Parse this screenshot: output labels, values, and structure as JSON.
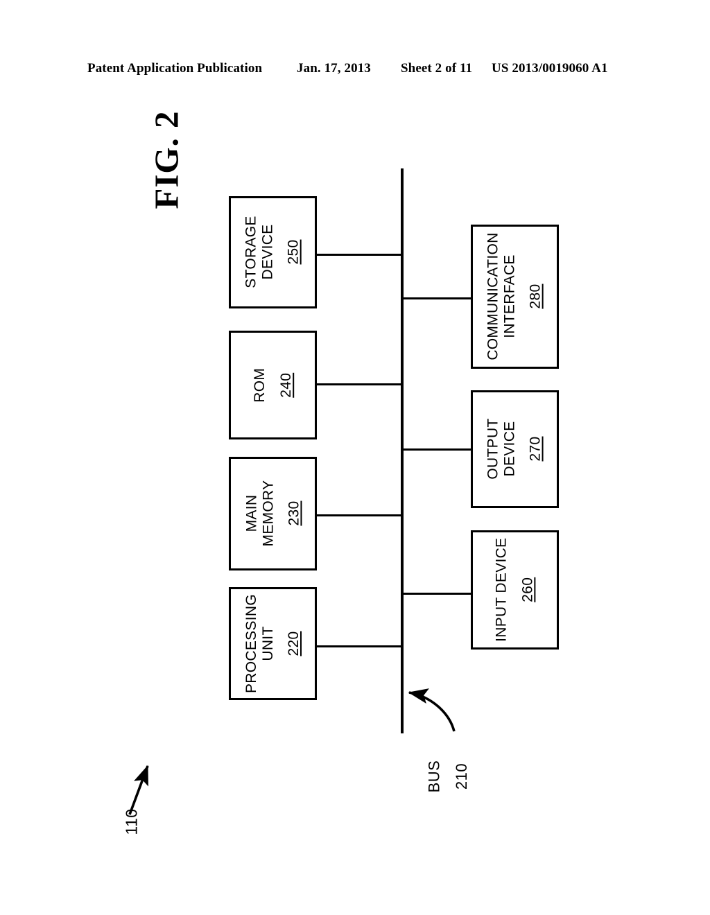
{
  "header": {
    "publication": "Patent Application Publication",
    "date": "Jan. 17, 2013",
    "sheet": "Sheet 2 of 11",
    "patent_number": "US 2013/0019060 A1"
  },
  "figure": {
    "title": "FIG. 2",
    "system_ref": "110",
    "bus_label": "BUS",
    "bus_ref": "210",
    "nodes": [
      {
        "id": "storage-device",
        "label": "STORAGE\nDEVICE",
        "ref": "250"
      },
      {
        "id": "rom",
        "label": "ROM",
        "ref": "240"
      },
      {
        "id": "main-memory",
        "label": "MAIN\nMEMORY",
        "ref": "230"
      },
      {
        "id": "processing-unit",
        "label": "PROCESSING\nUNIT",
        "ref": "220"
      },
      {
        "id": "communication-interface",
        "label": "COMMUNICATION\nINTERFACE",
        "ref": "280"
      },
      {
        "id": "output-device",
        "label": "OUTPUT\nDEVICE",
        "ref": "270"
      },
      {
        "id": "input-device",
        "label": "INPUT DEVICE",
        "ref": "260"
      }
    ]
  },
  "colors": {
    "ink": "#000000",
    "paper": "#ffffff"
  }
}
